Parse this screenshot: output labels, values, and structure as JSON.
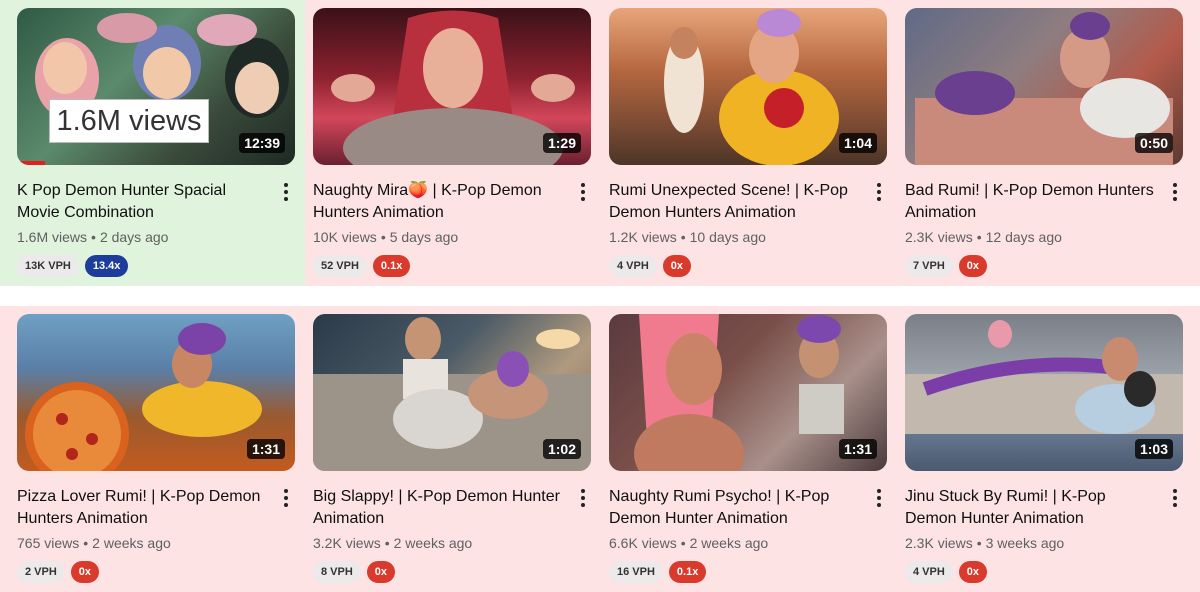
{
  "colors": {
    "outlier_bg": "#dff3dd",
    "normal_bg": "#fde3e4",
    "mult_high": "#1e3c9c",
    "mult_low": "#d93a2b",
    "duration_bg": "#000000"
  },
  "rows": [
    [
      {
        "title": "K Pop Demon Hunter Spacial Movie Combination",
        "views": "1.6M views",
        "age": "2 days ago",
        "duration": "12:39",
        "vph": "13K VPH",
        "multiplier": "13.4x",
        "overlay_views": "1.6M views",
        "watched_fraction": 0.1,
        "highlight": "outlier"
      },
      {
        "title": "Naughty Mira🍑 | K-Pop Demon Hunters Animation",
        "views": "10K views",
        "age": "5 days ago",
        "duration": "1:29",
        "vph": "52 VPH",
        "multiplier": "0.1x"
      },
      {
        "title": "Rumi Unexpected Scene! | K-Pop Demon Hunters Animation",
        "views": "1.2K views",
        "age": "10 days ago",
        "duration": "1:04",
        "vph": "4 VPH",
        "multiplier": "0x"
      },
      {
        "title": "Bad Rumi! | K-Pop Demon Hunters Animation",
        "views": "2.3K views",
        "age": "12 days ago",
        "duration": "0:50",
        "vph": "7 VPH",
        "multiplier": "0x"
      }
    ],
    [
      {
        "title": "Pizza Lover Rumi! | K-Pop Demon Hunters Animation",
        "views": "765 views",
        "age": "2 weeks ago",
        "duration": "1:31",
        "vph": "2 VPH",
        "multiplier": "0x"
      },
      {
        "title": "Big Slappy! | K-Pop Demon Hunter Animation",
        "views": "3.2K views",
        "age": "2 weeks ago",
        "duration": "1:02",
        "vph": "8 VPH",
        "multiplier": "0x"
      },
      {
        "title": "Naughty Rumi Psycho! | K-Pop Demon Hunter Animation",
        "views": "6.6K views",
        "age": "2 weeks ago",
        "duration": "1:31",
        "vph": "16 VPH",
        "multiplier": "0.1x"
      },
      {
        "title": "Jinu Stuck By Rumi! | K-Pop Demon Hunter Animation",
        "views": "2.3K views",
        "age": "3 weeks ago",
        "duration": "1:03",
        "vph": "4 VPH",
        "multiplier": "0x"
      }
    ]
  ],
  "separator": "•"
}
